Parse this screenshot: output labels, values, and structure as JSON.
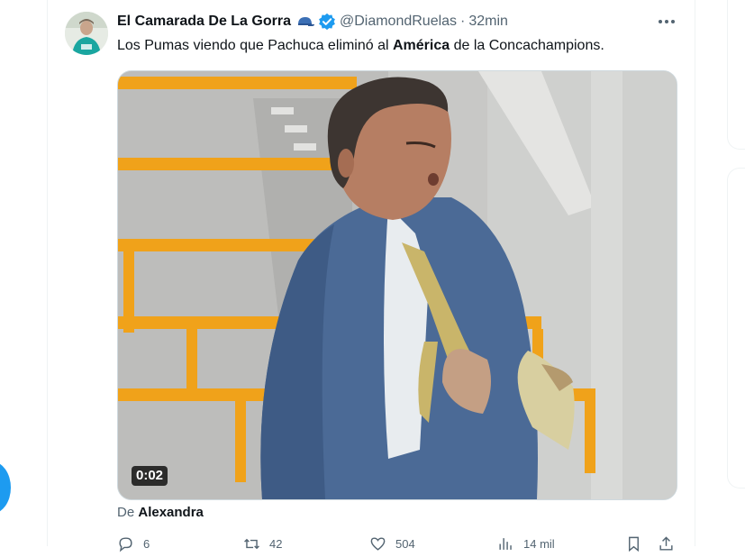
{
  "tweet": {
    "author_name": "El Camarada De La Gorra",
    "author_emoji": "cap-icon",
    "verified": true,
    "handle": "@DiamondRuelas",
    "separator": "·",
    "time": "32min",
    "text_before": "Los Pumas viendo que Pachuca eliminó al ",
    "text_bold": "América",
    "text_after": " de la Concachampions.",
    "media": {
      "type": "video",
      "duration": "0:02"
    },
    "credit_prefix": "De",
    "credit_name": "Alexandra",
    "stats": {
      "replies": "6",
      "reposts": "42",
      "likes": "504",
      "views": "14 mil"
    }
  },
  "colors": {
    "accent": "#1d9bf0",
    "secondary_text": "#536471",
    "primary_text": "#0f1419"
  }
}
